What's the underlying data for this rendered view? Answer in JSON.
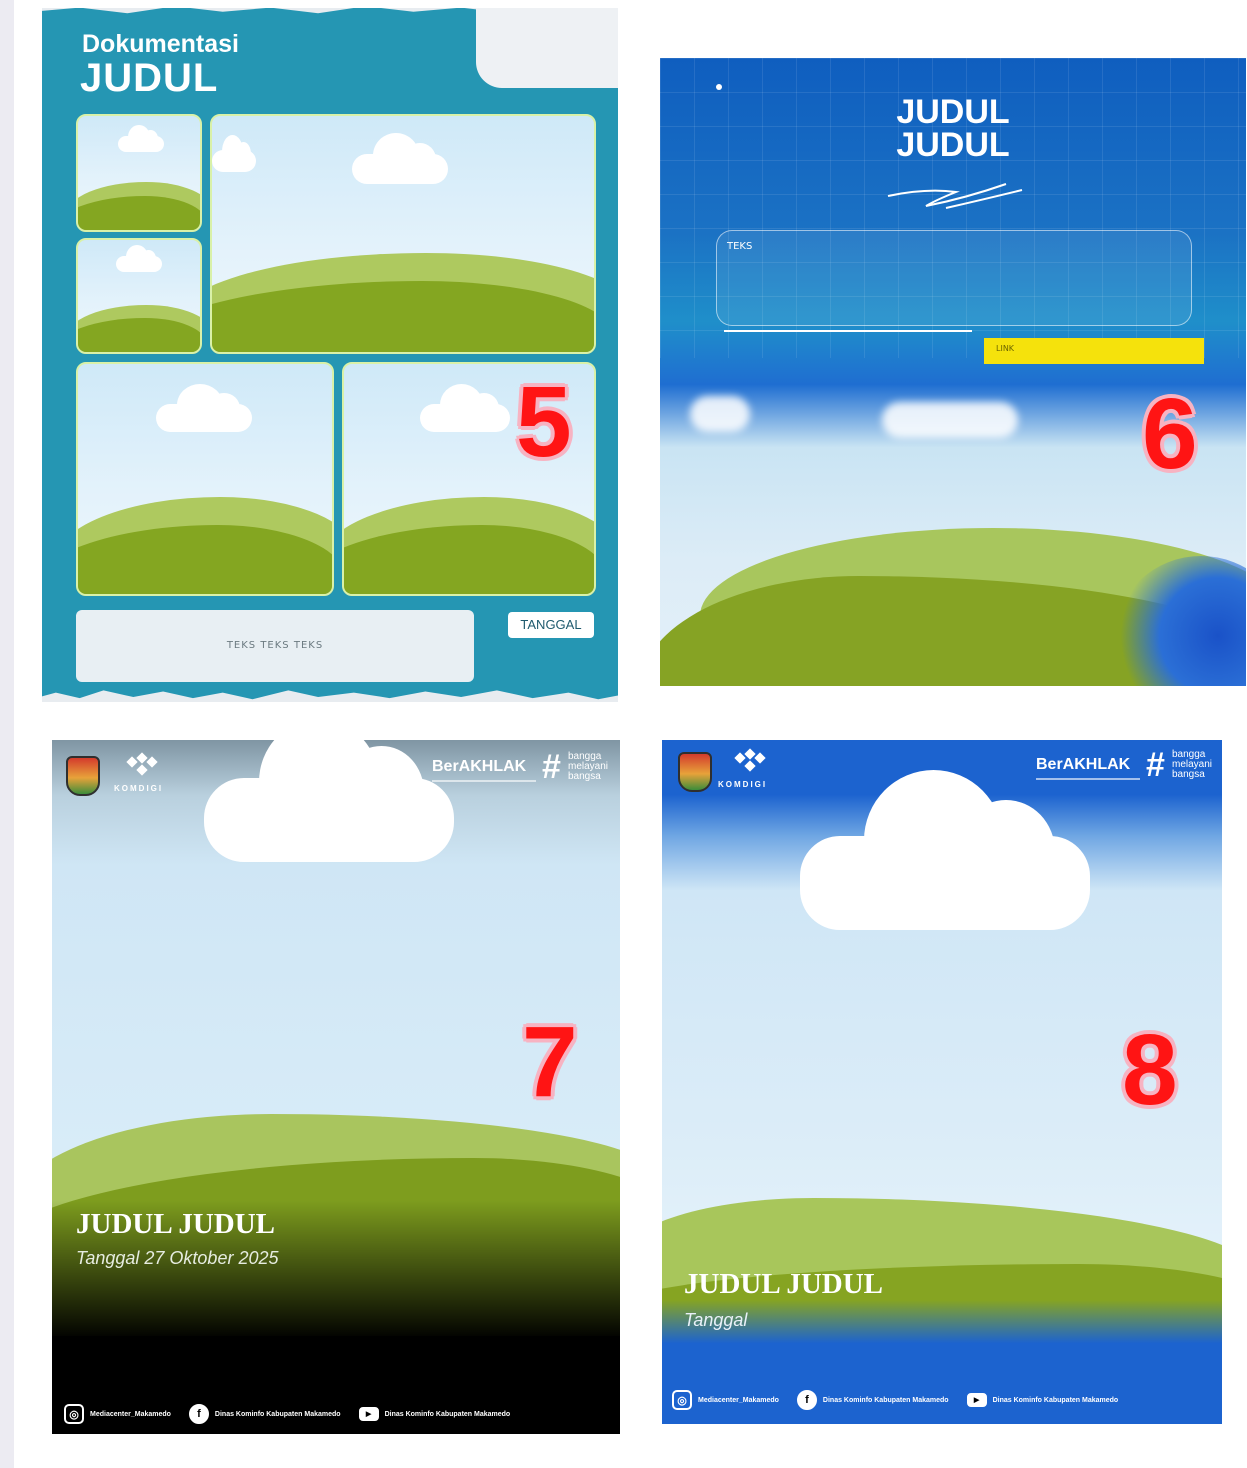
{
  "template_5": {
    "doc_label": "Dokumentasi",
    "title": "JUDUL",
    "caption": "TEKS TEKS TEKS",
    "date_tag": "TANGGAL",
    "number": "5"
  },
  "template_6": {
    "title_line1": "JUDUL",
    "title_line2": "JUDUL",
    "text_label": "TEKS",
    "yellow_label": "LINK",
    "number": "6"
  },
  "template_7": {
    "komdigi": "KOMDIGI",
    "berakhlak": "BerAKHLAK",
    "hash": "#",
    "bangga_line1": "bangga",
    "bangga_line2": "melayani",
    "bangga_line3": "bangsa",
    "title": "JUDUL JUDUL",
    "subtitle": "Tanggal 27 Oktober 2025",
    "number": "7",
    "social": {
      "instagram": "Mediacenter_Makamedo",
      "facebook": "Dinas Kominfo Kabupaten Makamedo",
      "youtube": "Dinas Kominfo Kabupaten Makamedo"
    }
  },
  "template_8": {
    "komdigi": "KOMDIGI",
    "berakhlak": "BerAKHLAK",
    "hash": "#",
    "bangga_line1": "bangga",
    "bangga_line2": "melayani",
    "bangga_line3": "bangsa",
    "title": "JUDUL JUDUL",
    "subtitle": "Tanggal",
    "number": "8",
    "social": {
      "instagram": "Mediacenter_Makamedo",
      "facebook": "Dinas Kominfo Kabupaten Makamedo",
      "youtube": "Dinas Kominfo Kabupaten Makamedo"
    }
  },
  "icons": {
    "instagram": "instagram-icon",
    "facebook": "facebook-icon",
    "youtube": "youtube-icon"
  }
}
